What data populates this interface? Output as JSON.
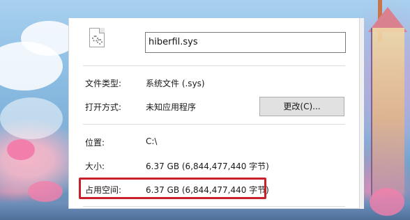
{
  "file": {
    "name": "hiberfil.sys"
  },
  "props": {
    "type_label": "文件类型:",
    "type_value": "系统文件 (.sys)",
    "open_label": "打开方式:",
    "open_value": "未知应用程序",
    "change_button": "更改(C)...",
    "location_label": "位置:",
    "location_value": "C:\\",
    "size_label": "大小:",
    "size_value": "6.37 GB (6,844,477,440 字节)",
    "disk_label": "占用空间:",
    "disk_value": "6.37 GB (6,844,477,440 字节)"
  },
  "colors": {
    "highlight": "#c8202a",
    "panel_bg": "#ffffff",
    "button_bg": "#e1e1e1"
  },
  "icons": {
    "file": "system-file-gear-icon"
  }
}
